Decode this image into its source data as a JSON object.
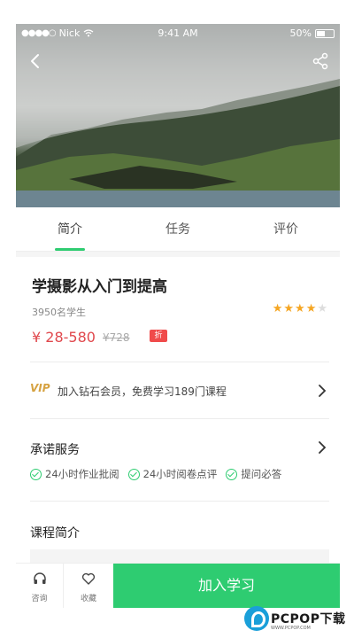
{
  "status_bar": {
    "carrier": "Nick",
    "time": "9:41 AM",
    "battery": "50%"
  },
  "hero": {
    "back_icon": "chevron-left-icon",
    "share_icon": "share-icon"
  },
  "tabs": [
    {
      "label": "简介",
      "active": true
    },
    {
      "label": "任务",
      "active": false
    },
    {
      "label": "评价",
      "active": false
    }
  ],
  "course": {
    "title": "学摄影从入门到提高",
    "students": "3950名学生",
    "rating_stars": 4,
    "rating_max": 5,
    "price": "¥ 28-580",
    "original_price": "¥728",
    "discount_badge": "折"
  },
  "vip": {
    "icon_label": "VIP",
    "text": "加入钻石会员，免费学习189门课程"
  },
  "promise": {
    "title": "承诺服务",
    "items": [
      "24小时作业批阅",
      "24小时阅卷点评",
      "提问必答"
    ]
  },
  "intro": {
    "title": "课程简介"
  },
  "bottom_bar": {
    "consult_label": "咨询",
    "favorite_label": "收藏",
    "join_label": "加入学习"
  },
  "watermark": {
    "brand": "PCPOP下载",
    "sub": "WWW.PCPOP.COM"
  },
  "colors": {
    "accent_green": "#2ecc71",
    "price_red": "#e0484d",
    "star_gold": "#f5a623",
    "vip_gold": "#d6a241"
  }
}
